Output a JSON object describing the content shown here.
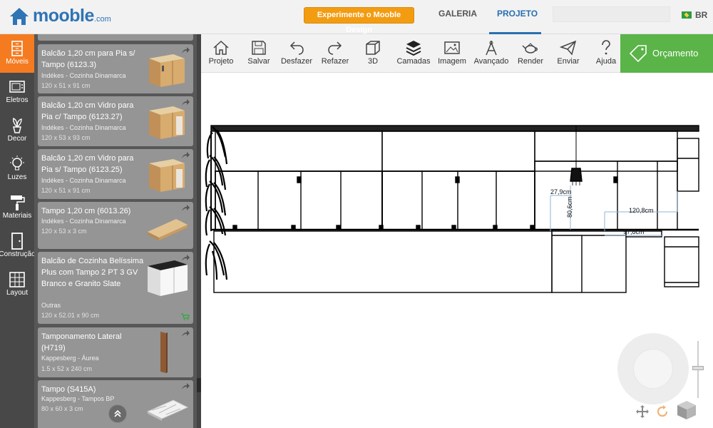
{
  "header": {
    "logo": "mooble",
    "logo_suffix": ".com",
    "promo_button": "Experimente o Mooble Design",
    "tabs": [
      {
        "label": "GALERIA",
        "active": false
      },
      {
        "label": "PROJETO",
        "active": true
      }
    ],
    "language": "BR"
  },
  "sidebar": {
    "items": [
      {
        "label": "Móveis",
        "icon": "drawers-icon",
        "active": true
      },
      {
        "label": "Eletros",
        "icon": "microwave-icon",
        "active": false
      },
      {
        "label": "Decor",
        "icon": "plant-icon",
        "active": false
      },
      {
        "label": "Luzes",
        "icon": "bulb-icon",
        "active": false
      },
      {
        "label": "Materiais",
        "icon": "paint-roller-icon",
        "active": false
      },
      {
        "label": "Construção",
        "icon": "door-icon",
        "active": false
      },
      {
        "label": "Layout",
        "icon": "grid-icon",
        "active": false
      }
    ]
  },
  "catalog": {
    "items": [
      {
        "title": "Balcão 1,20 cm para Pia s/ Tampo (6123.3)",
        "brand": "Indékes - Cozinha Dinamarca",
        "dims": "120 x 51 x 91 cm",
        "kind": "wood-cabinet"
      },
      {
        "title": "Balcão 1,20 cm Vidro para Pia c/ Tampo (6123.27)",
        "brand": "Indékes - Cozinha Dinamarca",
        "dims": "120 x 53 x 93 cm",
        "kind": "wood-cabinet"
      },
      {
        "title": "Balcão 1,20 cm Vidro para Pia s/ Tampo (6123.25)",
        "brand": "Indékes - Cozinha Dinamarca",
        "dims": "120 x 51 x 91 cm",
        "kind": "wood-cabinet"
      },
      {
        "title": "Tampo 1,20 cm (6013.26)",
        "brand": "Indékes - Cozinha Dinamarca",
        "dims": "120 x 53 x 3 cm",
        "kind": "wood-top"
      },
      {
        "title": "Balcão de Cozinha Belíssima Plus com Tampo 2 PT 3 GV Branco e Granito Slate",
        "brand": "Outras",
        "dims": "120 x 52.01 x 90 cm",
        "kind": "white-cabinet"
      },
      {
        "title": "Tamponamento Lateral (H719)",
        "brand": "Kappesberg - Áurea",
        "dims": "1.5 x 52 x 240 cm",
        "kind": "side-panel"
      },
      {
        "title": "Tampo (S415A)",
        "brand": "Kappesberg - Tampos BP",
        "dims": "80 x 60 x 3 cm",
        "kind": "marble-top"
      }
    ]
  },
  "toolbar": {
    "tools": [
      {
        "label": "Projeto",
        "icon": "house-icon"
      },
      {
        "label": "Salvar",
        "icon": "floppy-icon"
      },
      {
        "label": "Desfazer",
        "icon": "undo-icon"
      },
      {
        "label": "Refazer",
        "icon": "redo-icon"
      },
      {
        "label": "3D",
        "icon": "cube-icon"
      },
      {
        "label": "Camadas",
        "icon": "layers-icon"
      },
      {
        "label": "Imagem",
        "icon": "image-icon"
      },
      {
        "label": "Avançado",
        "icon": "compass-icon"
      },
      {
        "label": "Render",
        "icon": "teapot-icon"
      },
      {
        "label": "Enviar",
        "icon": "paper-plane-icon"
      },
      {
        "label": "Ajuda",
        "icon": "question-icon"
      }
    ],
    "quote_button": "Orçamento"
  },
  "drawing": {
    "dimensions": [
      "27,9cm",
      "80,6cm",
      "120,8cm",
      "97,8cm"
    ]
  }
}
